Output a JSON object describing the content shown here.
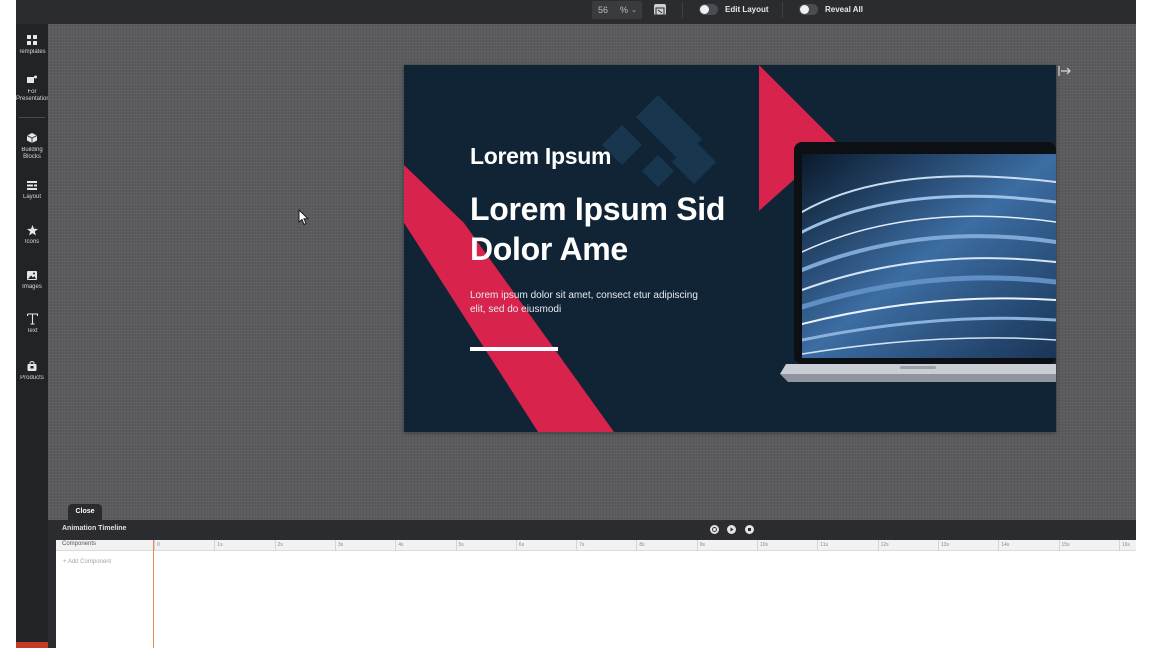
{
  "topbar": {
    "zoom_value": "56",
    "zoom_unit": "%",
    "zoom_caret": "⌄",
    "edit_layout_label": "Edit Layout",
    "reveal_all_label": "Reveal All"
  },
  "sidebar": {
    "items": [
      {
        "label": "Templates",
        "icon": "grid-icon"
      },
      {
        "label": "For Presentation",
        "icon": "presentation-icon"
      },
      {
        "label": "Building Blocks",
        "icon": "cube-icon"
      },
      {
        "label": "Layout",
        "icon": "layout-icon"
      },
      {
        "label": "Icons",
        "icon": "star-icon"
      },
      {
        "label": "Images",
        "icon": "image-icon"
      },
      {
        "label": "Text",
        "icon": "text-icon"
      },
      {
        "label": "Products",
        "icon": "bag-icon"
      }
    ]
  },
  "slide": {
    "subtitle": "Lorem Ipsum",
    "headline": "Lorem Ipsum Sid Dolor Ame",
    "body": "Lorem ipsum dolor sit amet, consect etur adipiscing elit, sed do eiusmodi",
    "colors": {
      "background": "#102436",
      "accent": "#d8234c"
    }
  },
  "timeline": {
    "close_label": "Close",
    "title": "Animation Timeline",
    "components_label": "Components",
    "add_component_label": "+ Add Component",
    "ticks": [
      "0",
      "1s",
      "2s",
      "3s",
      "4s",
      "5s",
      "6s",
      "7s",
      "8s",
      "9s",
      "10s",
      "11s",
      "12s",
      "13s",
      "14s",
      "15s",
      "16s"
    ]
  }
}
